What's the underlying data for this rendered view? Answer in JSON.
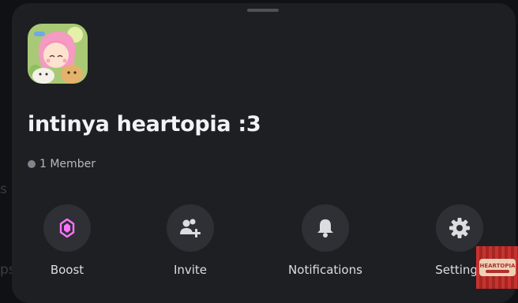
{
  "background": {
    "fragment_s": "s",
    "fragment_ps": "ps"
  },
  "server": {
    "name": "intinya heartopia :3",
    "member_count_text": "1 Member",
    "icon": "server-avatar-image"
  },
  "actions": [
    {
      "label": "Boost",
      "icon": "boost-gem-icon"
    },
    {
      "label": "Invite",
      "icon": "invite-user-icon"
    },
    {
      "label": "Notifications",
      "icon": "bell-icon"
    },
    {
      "label": "Settings",
      "icon": "gear-icon"
    }
  ],
  "corner_logo": {
    "text": "HEARTOPIA"
  },
  "colors": {
    "sheet_bg": "#1e1f22",
    "button_bg": "#2e3035",
    "boost_accent": "#ff73fa",
    "text_primary": "#f2f3f5",
    "text_muted": "#b5bac1"
  }
}
